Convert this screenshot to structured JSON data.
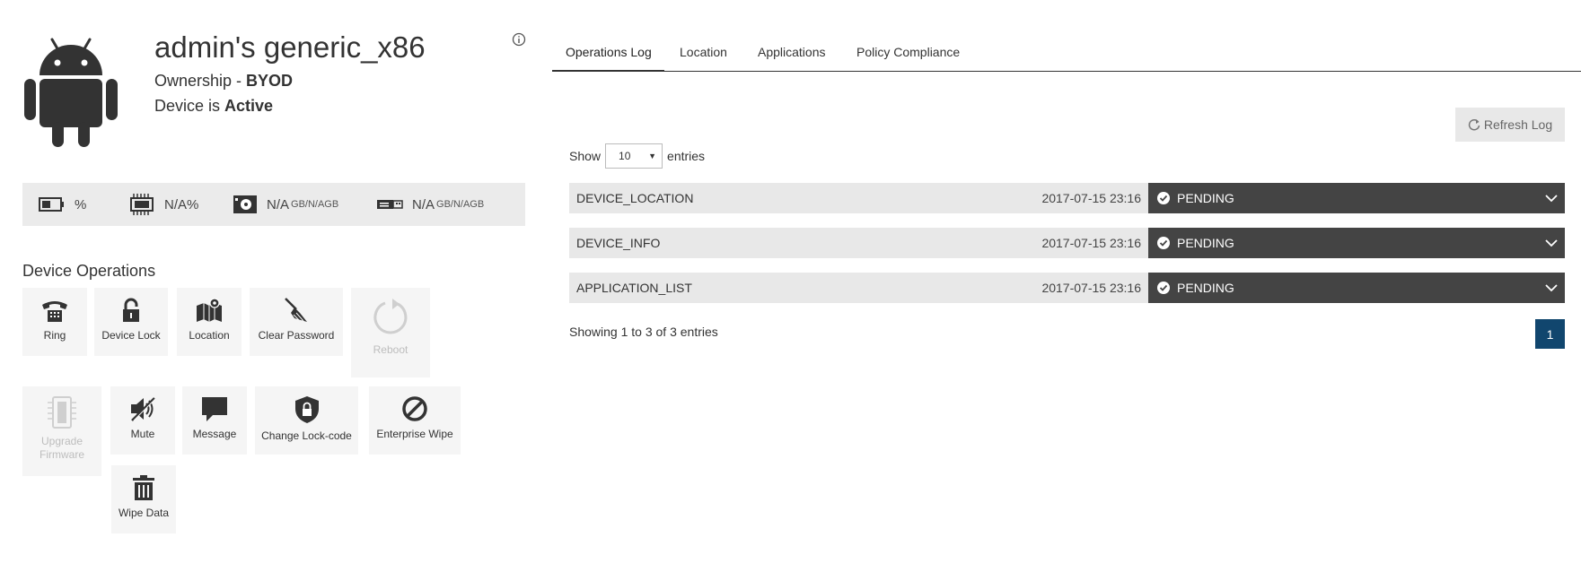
{
  "device": {
    "title": "admin's generic_x86",
    "ownership_prefix": "Ownership - ",
    "ownership_value": "BYOD",
    "status_prefix": "Device is ",
    "status_value": "Active",
    "icon": "android-icon"
  },
  "stats": {
    "battery": "%",
    "cpu": "N/A%",
    "storage_value": "N/A",
    "storage_unit": "GB/N/AGB",
    "usb_value": "N/A",
    "usb_unit": "GB/N/AGB"
  },
  "operations": {
    "title": "Device Operations",
    "items": [
      {
        "label": "Ring",
        "icon": "phone-icon",
        "enabled": true
      },
      {
        "label": "Device Lock",
        "icon": "lock-icon",
        "enabled": true
      },
      {
        "label": "Location",
        "icon": "map-icon",
        "enabled": true
      },
      {
        "label": "Clear Password",
        "icon": "broom-icon",
        "enabled": true
      },
      {
        "label": "Reboot",
        "icon": "reboot-icon",
        "enabled": false
      },
      {
        "label": "Upgrade Firmware",
        "icon": "chip-icon",
        "enabled": false
      },
      {
        "label": "Mute",
        "icon": "mute-icon",
        "enabled": true
      },
      {
        "label": "Message",
        "icon": "message-icon",
        "enabled": true
      },
      {
        "label": "Change Lock-code",
        "icon": "shield-lock-icon",
        "enabled": true
      },
      {
        "label": "Enterprise Wipe",
        "icon": "block-icon",
        "enabled": true
      },
      {
        "label": "Wipe Data",
        "icon": "trash-icon",
        "enabled": true
      }
    ]
  },
  "tabs": [
    {
      "label": "Operations Log",
      "active": true
    },
    {
      "label": "Location",
      "active": false
    },
    {
      "label": "Applications",
      "active": false
    },
    {
      "label": "Policy Compliance",
      "active": false
    }
  ],
  "log": {
    "refresh_label": "Refresh Log",
    "show_label": "Show",
    "entries_label": "entries",
    "page_size": "10",
    "rows": [
      {
        "operation": "DEVICE_LOCATION",
        "time": "2017-07-15 23:16",
        "status": "PENDING"
      },
      {
        "operation": "DEVICE_INFO",
        "time": "2017-07-15 23:16",
        "status": "PENDING"
      },
      {
        "operation": "APPLICATION_LIST",
        "time": "2017-07-15 23:16",
        "status": "PENDING"
      }
    ],
    "summary": "Showing 1 to 3 of 3 entries",
    "current_page": "1"
  },
  "colors": {
    "status_bg": "#444444",
    "page_active": "#11466e",
    "panel_bg": "#ebebeb"
  }
}
